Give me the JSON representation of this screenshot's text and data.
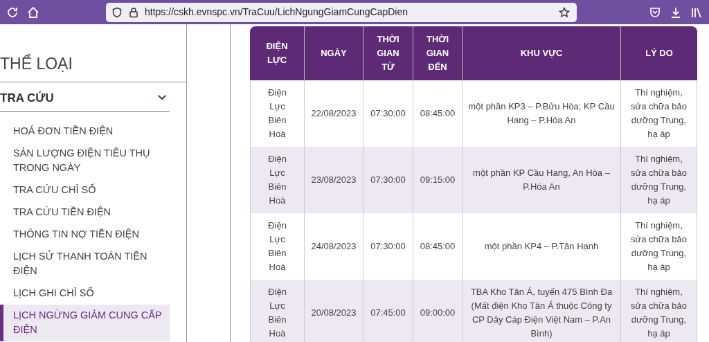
{
  "browser": {
    "url": "https://cskh.evnspc.vn/TraCuu/LichNgungGiamCungCapDien"
  },
  "sidebar": {
    "title": "THỂ LOẠI",
    "section": {
      "label": "TRA CỨU",
      "expanded": true
    },
    "items": [
      {
        "label": "HOÁ ĐƠN TIỀN ĐIỆN",
        "selected": false
      },
      {
        "label": "SẢN LƯỢNG ĐIỆN TIÊU THỤ TRONG NGÀY",
        "selected": false
      },
      {
        "label": "TRA CỨU CHỈ SỐ",
        "selected": false
      },
      {
        "label": "TRA CỨU TIỀN ĐIỆN",
        "selected": false
      },
      {
        "label": "THÔNG TIN NỢ TIỀN ĐIỆN",
        "selected": false
      },
      {
        "label": "LỊCH SỬ THANH TOÁN TIỀN ĐIỆN",
        "selected": false
      },
      {
        "label": "LỊCH GHI CHỈ SỐ",
        "selected": false
      },
      {
        "label": "LỊCH NGỪNG GIẢM CUNG CẤP ĐIỆN",
        "selected": true
      }
    ]
  },
  "table": {
    "columns": [
      "ĐIỆN LỰC",
      "NGÀY",
      "THỜI GIAN TỪ",
      "THỜI GIAN ĐẾN",
      "KHU VỰC",
      "LÝ DO"
    ],
    "rows": [
      [
        "Điện Lực Biên Hoà",
        "22/08/2023",
        "07:30:00",
        "08:45:00",
        "một phần KP3 – P.Bửu Hòa; KP Cầu Hang – P.Hóa An",
        "Thí nghiệm, sửa chữa bảo dưỡng Trung, hạ áp"
      ],
      [
        "Điện Lực Biên Hoà",
        "23/08/2023",
        "07:30:00",
        "09:15:00",
        "một phần KP Cầu Hang, An Hòa – P.Hóa An",
        "Thí nghiệm, sửa chữa bảo dưỡng Trung, hạ áp"
      ],
      [
        "Điện Lực Biên Hoà",
        "24/08/2023",
        "07:30:00",
        "08:45:00",
        "một phần KP4 – P.Tân Hạnh",
        "Thí nghiệm, sửa chữa bảo dưỡng Trung, hạ áp"
      ],
      [
        "Điện Lực Biên Hoà",
        "20/08/2023",
        "07:45:00",
        "09:00:00",
        "TBA Kho Tân Á, tuyến 475 Bình Đa (Mất điện Kho Tân Á thuộc Công ty CP Dây Cáp Điện Việt Nam – P.An Bình)",
        "Thí nghiệm, sửa chữa bảo dưỡng Trung, hạ áp"
      ]
    ]
  }
}
